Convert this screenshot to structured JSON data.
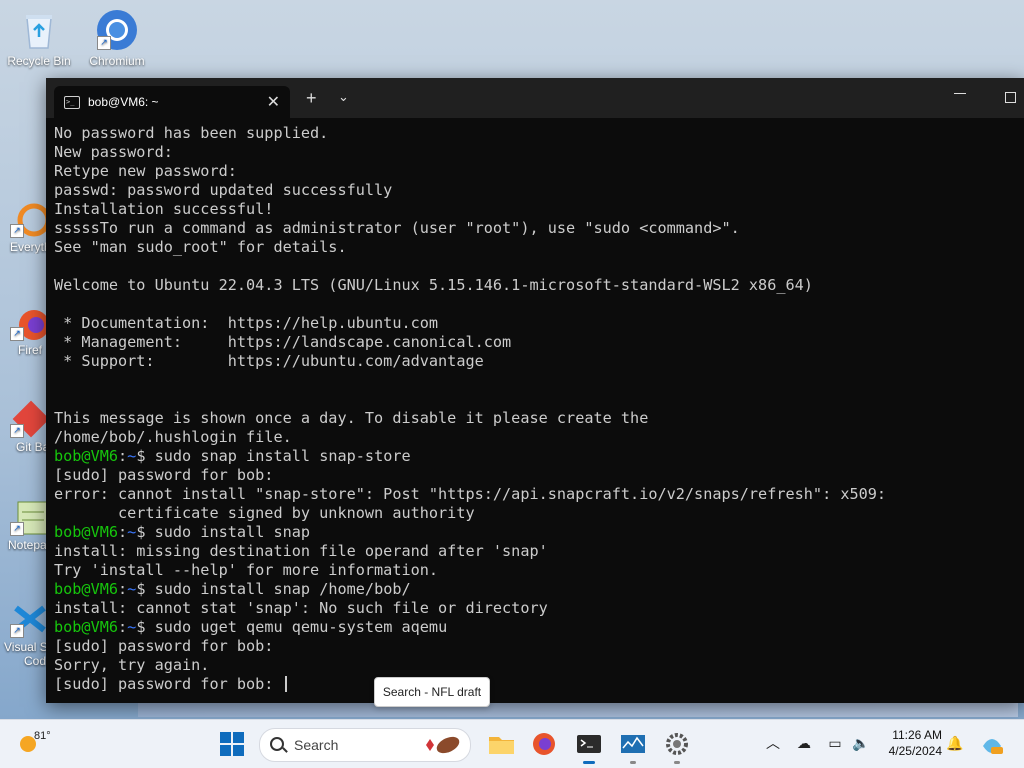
{
  "desktop": {
    "icons": [
      {
        "label": "Recycle Bin"
      },
      {
        "label": "Chromium"
      }
    ],
    "partial_icons": [
      {
        "label": "Everyth"
      },
      {
        "label": "Firef"
      },
      {
        "label": "Git Ba"
      },
      {
        "label": "Notepa"
      },
      {
        "label": "Visual S"
      },
      {
        "label": "Cod"
      }
    ]
  },
  "terminal": {
    "tab_title": "bob@VM6: ~",
    "prompt_user": "bob@VM6",
    "prompt_path": "~",
    "lines": [
      {
        "text": "No password has been supplied."
      },
      {
        "text": "New password:"
      },
      {
        "text": "Retype new password:"
      },
      {
        "text": "passwd: password updated successfully"
      },
      {
        "text": "Installation successful!"
      },
      {
        "text": "sssssTo run a command as administrator (user \"root\"), use \"sudo <command>\"."
      },
      {
        "text": "See \"man sudo_root\" for details."
      },
      {
        "text": ""
      },
      {
        "text": "Welcome to Ubuntu 22.04.3 LTS (GNU/Linux 5.15.146.1-microsoft-standard-WSL2 x86_64)"
      },
      {
        "text": ""
      },
      {
        "text": " * Documentation:  https://help.ubuntu.com"
      },
      {
        "text": " * Management:     https://landscape.canonical.com"
      },
      {
        "text": " * Support:        https://ubuntu.com/advantage"
      },
      {
        "text": ""
      },
      {
        "text": ""
      },
      {
        "text": "This message is shown once a day. To disable it please create the"
      },
      {
        "text": "/home/bob/.hushlogin file."
      },
      {
        "prompt": true,
        "text": "$ sudo snap install snap-store"
      },
      {
        "text": "[sudo] password for bob:"
      },
      {
        "text": "error: cannot install \"snap-store\": Post \"https://api.snapcraft.io/v2/snaps/refresh\": x509:"
      },
      {
        "text": "       certificate signed by unknown authority"
      },
      {
        "prompt": true,
        "text": "$ sudo install snap"
      },
      {
        "text": "install: missing destination file operand after 'snap'"
      },
      {
        "text": "Try 'install --help' for more information."
      },
      {
        "prompt": true,
        "text": "$ sudo install snap /home/bob/"
      },
      {
        "text": "install: cannot stat 'snap': No such file or directory"
      },
      {
        "prompt": true,
        "text": "$ sudo uget qemu qemu-system aqemu"
      },
      {
        "text": "[sudo] password for bob:"
      },
      {
        "text": "Sorry, try again."
      },
      {
        "text": "[sudo] password for bob: ",
        "cursor": true
      }
    ]
  },
  "tooltip": {
    "text": "Search - NFL draft"
  },
  "taskbar": {
    "weather_temp": "81°",
    "search_label": "Search",
    "clock_time": "11:26 AM",
    "clock_date": "4/25/2024"
  }
}
